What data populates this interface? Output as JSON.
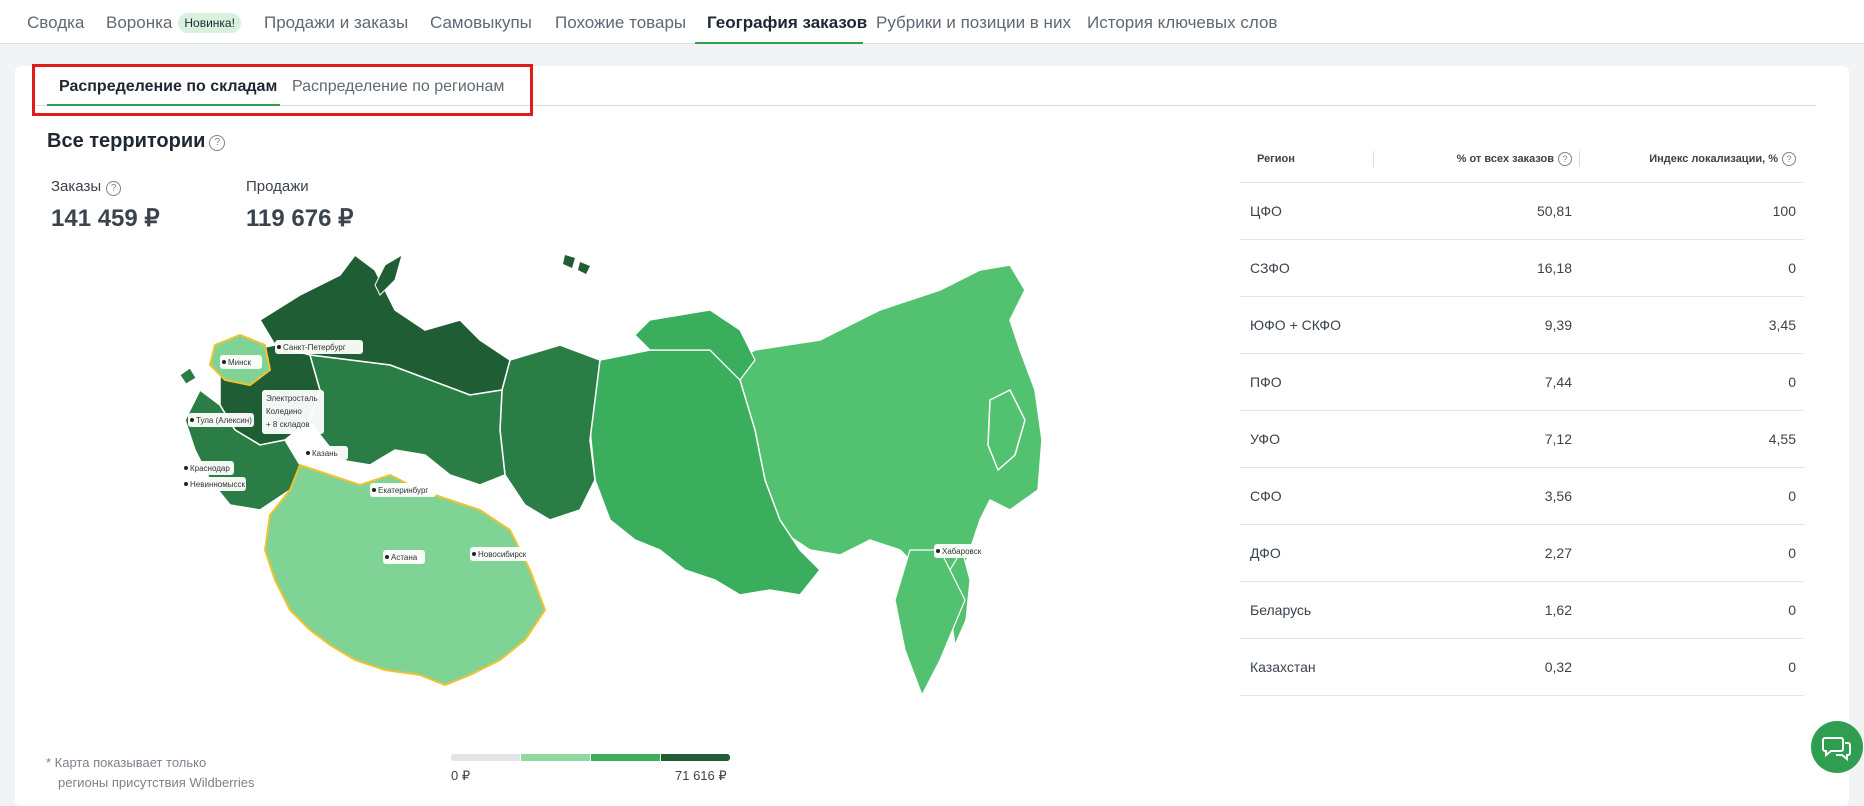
{
  "nav": {
    "tabs": [
      {
        "label": "Сводка"
      },
      {
        "label": "Воронка",
        "badge": "Новинка!"
      },
      {
        "label": "Продажи и заказы"
      },
      {
        "label": "Самовыкупы"
      },
      {
        "label": "Похожие товары"
      },
      {
        "label": "География заказов",
        "active": true
      },
      {
        "label": "Рубрики и позиции в них"
      },
      {
        "label": "История ключевых слов"
      }
    ]
  },
  "subtabs": [
    {
      "label": "Распределение по складам",
      "active": true
    },
    {
      "label": "Распределение по регионам",
      "active": false
    }
  ],
  "section_title": "Все территории",
  "metrics": {
    "orders_label": "Заказы",
    "orders_value": "141 459 ₽",
    "sales_label": "Продажи",
    "sales_value": "119 676 ₽"
  },
  "map": {
    "cities": {
      "spb": "Санкт-Петербург",
      "minsk": "Минск",
      "elektrostal": "Электросталь",
      "koledino": "Коледино",
      "more": "+ 8 складов",
      "tula": "Тула (Алексин)",
      "kazan": "Казань",
      "krasnodar": "Краснодар",
      "nevinnomyssk": "Невинномысск",
      "ekaterinburg": "Екатеринбург",
      "astana": "Астана",
      "novosibirsk": "Новосибирск",
      "khabarovsk": "Хабаровск"
    },
    "colors": {
      "darkest": "#1f5e35",
      "dark": "#2a7d45",
      "medium": "#3aae5d",
      "light": "#52c170",
      "lightest": "#7fd394",
      "border_kz": "#f2c230"
    }
  },
  "footnote": {
    "line1": "* Карта показывает только",
    "line2": "регионы присутствия Wildberries"
  },
  "legend": {
    "min": "0 ₽",
    "max": "71 616 ₽",
    "colors": [
      "#e2e4e8",
      "#8fd8a0",
      "#3aae5d",
      "#1f5e35"
    ]
  },
  "table": {
    "headers": {
      "region": "Регион",
      "pct": "% от всех заказов",
      "index": "Индекс локализации, %"
    },
    "rows": [
      {
        "region": "ЦФО",
        "pct": "50,81",
        "index": "100"
      },
      {
        "region": "СЗФО",
        "pct": "16,18",
        "index": "0"
      },
      {
        "region": "ЮФО + СКФО",
        "pct": "9,39",
        "index": "3,45"
      },
      {
        "region": "ПФО",
        "pct": "7,44",
        "index": "0"
      },
      {
        "region": "УФО",
        "pct": "7,12",
        "index": "4,55"
      },
      {
        "region": "СФО",
        "pct": "3,56",
        "index": "0"
      },
      {
        "region": "ДФО",
        "pct": "2,27",
        "index": "0"
      },
      {
        "region": "Беларусь",
        "pct": "1,62",
        "index": "0"
      },
      {
        "region": "Казахстан",
        "pct": "0,32",
        "index": "0"
      }
    ]
  }
}
